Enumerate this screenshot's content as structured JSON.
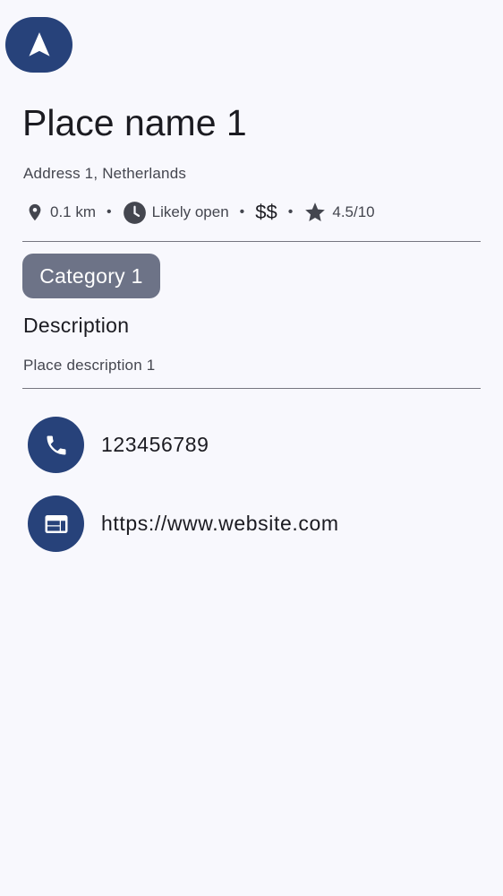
{
  "header": {
    "navigate_icon": "navigation-arrow-icon"
  },
  "place": {
    "name": "Place name 1",
    "address": "Address 1, Netherlands",
    "distance": "0.1 km",
    "open_status": "Likely open",
    "price": "$$",
    "rating": "4.5/10",
    "separator": "•",
    "category": "Category 1",
    "description_heading": "Description",
    "description": "Place description 1"
  },
  "contacts": {
    "phone": "123456789",
    "website": "https://www.website.com"
  },
  "colors": {
    "background": "#f8f8fd",
    "primary": "#27427a",
    "chip": "#6d7387",
    "text": "#1b1b21",
    "secondary_text": "#44464f",
    "divider": "#767680"
  }
}
